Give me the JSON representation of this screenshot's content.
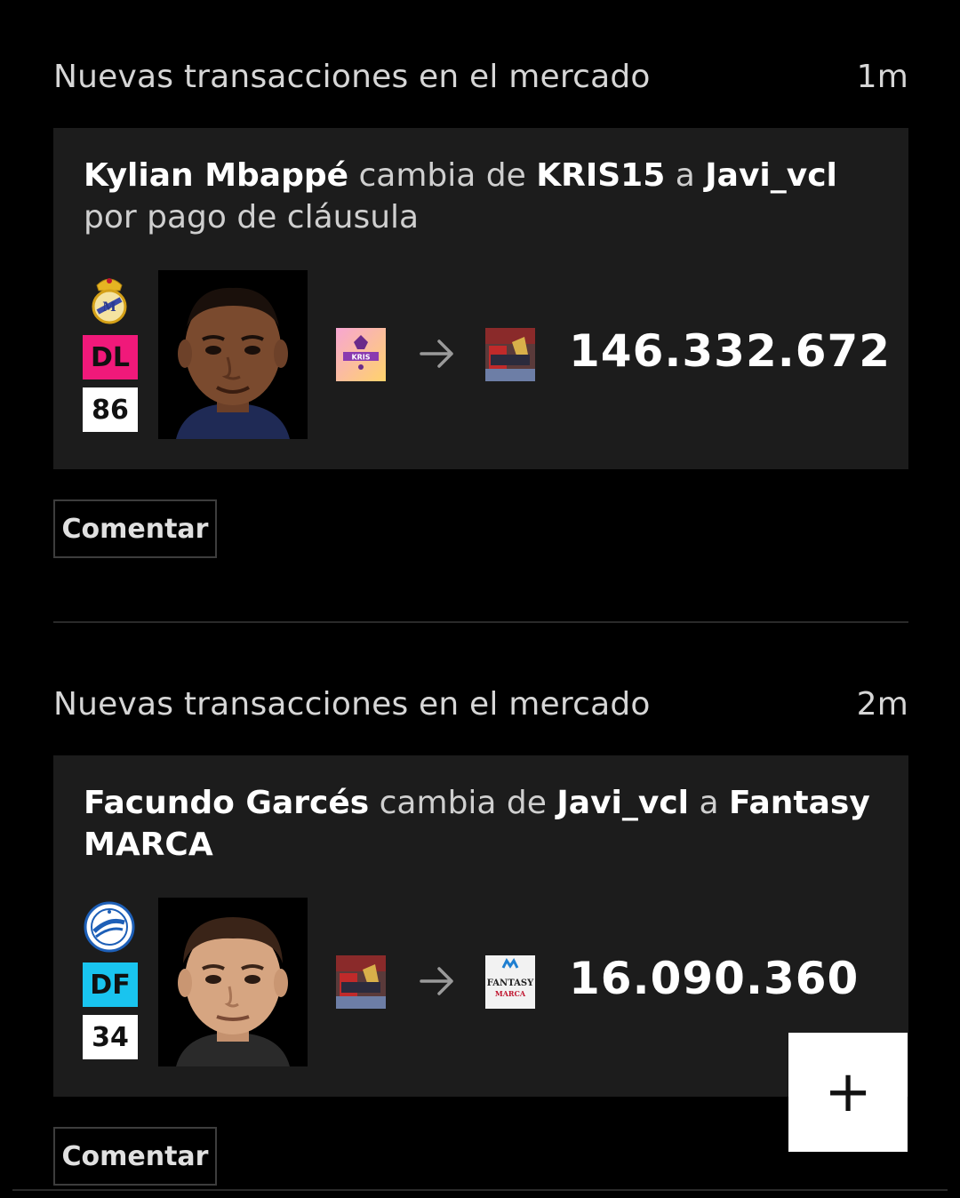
{
  "posts": [
    {
      "header": "Nuevas transacciones en el mercado",
      "time": "1m",
      "player": "Kylian Mbappé",
      "t1": "cambia de",
      "from": "KRIS15",
      "t2": "a",
      "to": "Javi_vcl",
      "t3": "por pago de cláusula",
      "position": "DL",
      "position_color": "#f0197a",
      "score": "86",
      "club_icon": "real-madrid-crest-icon",
      "from_logo": "kris-team-logo",
      "to_logo": "javi-team-logo",
      "price": "146.332.672",
      "comment_label": "Comentar"
    },
    {
      "header": "Nuevas transacciones en el mercado",
      "time": "2m",
      "player": "Facundo Garcés",
      "t1": "cambia de",
      "from": "Javi_vcl",
      "t2": "a",
      "to": "Fantasy MARCA",
      "position": "DF",
      "position_color": "#19c4ef",
      "score": "34",
      "club_icon": "alaves-crest-icon",
      "from_logo": "javi-team-logo",
      "to_logo": "fantasy-marca-logo",
      "to_logo_text": "FANTASY MARCA",
      "price": "16.090.360",
      "comment_label": "Comentar"
    }
  ],
  "fab": {
    "symbol": "+"
  }
}
